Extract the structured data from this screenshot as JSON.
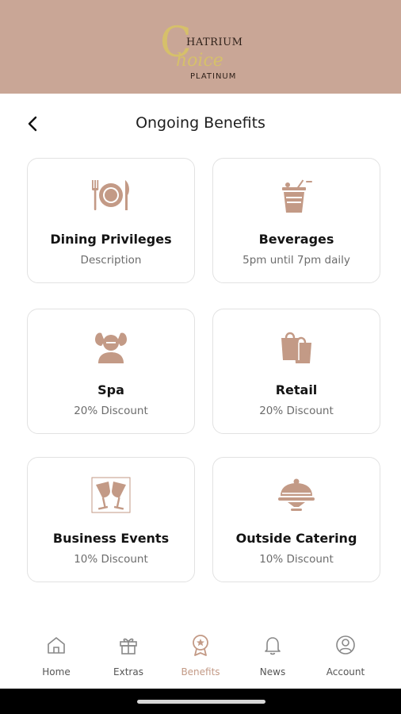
{
  "logo": {
    "initial": "C",
    "top": "HATRIUM",
    "script": "hoice",
    "bottom": "PLATINUM"
  },
  "page": {
    "title": "Ongoing Benefits",
    "back_icon": "chevron-left-icon"
  },
  "benefits": [
    {
      "title": "Dining Privileges",
      "desc": "Description",
      "icon": "dining-plate-icon"
    },
    {
      "title": "Beverages",
      "desc": "5pm until 7pm daily",
      "icon": "drink-glass-icon"
    },
    {
      "title": "Spa",
      "desc": "20% Discount",
      "icon": "spa-massage-icon"
    },
    {
      "title": "Retail",
      "desc": "20% Discount",
      "icon": "shopping-bag-icon"
    },
    {
      "title": "Business Events",
      "desc": "10% Discount",
      "icon": "champagne-glasses-icon"
    },
    {
      "title": "Outside Catering",
      "desc": "10% Discount",
      "icon": "cloche-icon"
    }
  ],
  "tabs": [
    {
      "label": "Home",
      "icon": "home-icon"
    },
    {
      "label": "Extras",
      "icon": "gift-icon"
    },
    {
      "label": "Benefits",
      "icon": "award-icon",
      "active": true
    },
    {
      "label": "News",
      "icon": "bell-icon"
    },
    {
      "label": "Account",
      "icon": "user-circle-icon"
    }
  ],
  "colors": {
    "header_bg": "#c9a696",
    "accent": "#c39a86",
    "logo_gold": "#d6c06a"
  }
}
